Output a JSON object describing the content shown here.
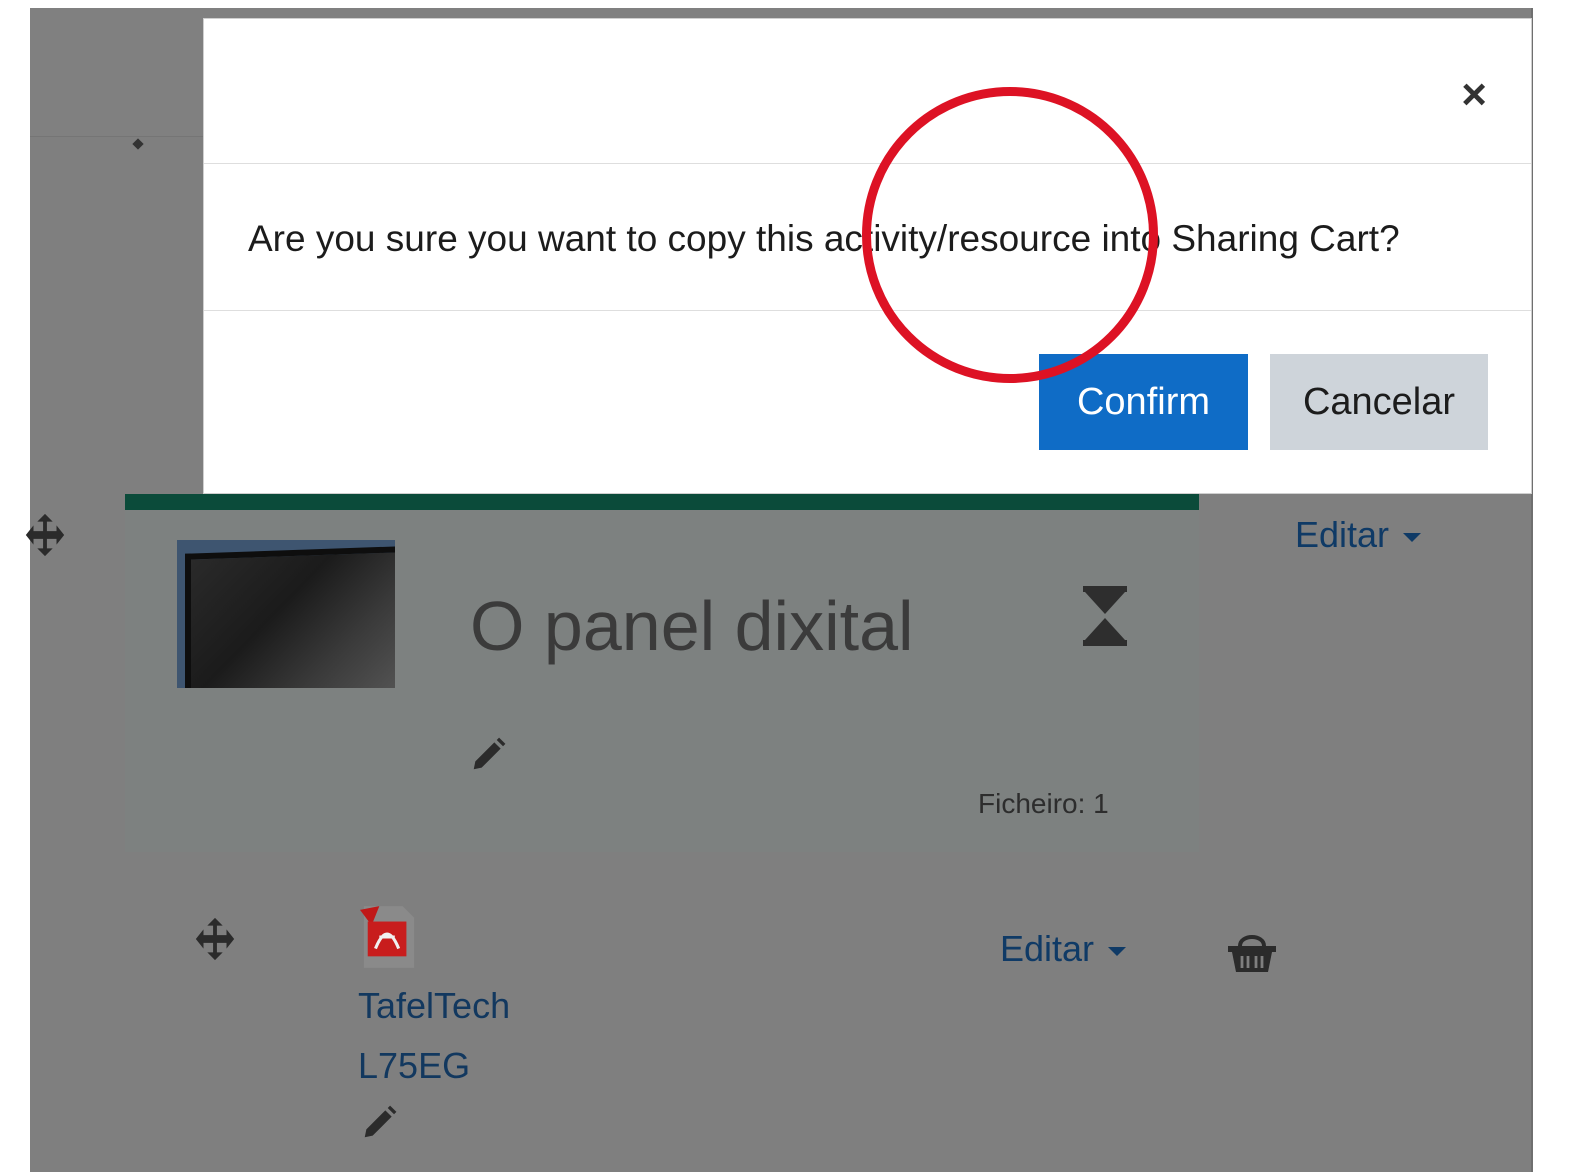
{
  "modal": {
    "close_symbol": "×",
    "message": "Are you sure you want to copy this activity/resource into Sharing Cart?",
    "confirm_label": "Confirm",
    "cancel_label": "Cancelar"
  },
  "section": {
    "title": "O panel dixital",
    "files_label": "Ficheiro: 1",
    "edit_label": "Editar"
  },
  "activity": {
    "name_line1": "TafelTech",
    "name_line2": "L75EG",
    "edit_label": "Editar"
  },
  "icons": {
    "move": "move-icon",
    "hourglass": "hourglass-icon",
    "pencil": "pencil-icon",
    "pdf": "pdf-icon",
    "basket": "basket-icon"
  },
  "colors": {
    "primary_button": "#0f6cc6",
    "secondary_button": "#ced4da",
    "link": "#0f3a66",
    "annotation": "#dd1224",
    "section_border": "#0b4b3a"
  }
}
